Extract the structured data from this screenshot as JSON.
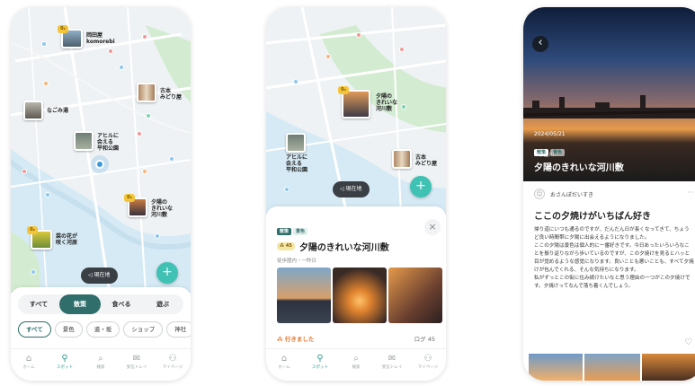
{
  "colors": {
    "accent": "#2f6e6a",
    "teal": "#3fc1b4",
    "water": "#d6eaf5",
    "park": "#d3ecd1"
  },
  "tabbar": [
    {
      "icon": "⌂",
      "label": "ホーム"
    },
    {
      "icon": "⚲",
      "label": "スポット"
    },
    {
      "icon": "⌕",
      "label": "検索"
    },
    {
      "icon": "✉",
      "label": "受信トレイ"
    },
    {
      "icon": "⚇",
      "label": "マイページ"
    }
  ],
  "screen1": {
    "places": [
      {
        "name": "岡田屋\nkomorebi"
      },
      {
        "name": "古本\nみどり屋"
      },
      {
        "name": "なごみ湯"
      },
      {
        "name": "アヒルに\n会える\n平和公園"
      },
      {
        "name": "夕陽の\nきれいな\n河川敷"
      },
      {
        "name": "菜の花が\n咲く河原"
      }
    ],
    "badge": "0₀",
    "current_location": "現在地",
    "fab_icon": "+",
    "segments": [
      "すべて",
      "散策",
      "食べる",
      "遊ぶ"
    ],
    "filters": [
      "すべて",
      "景色",
      "道・坂",
      "ショップ",
      "神社"
    ]
  },
  "screen2": {
    "places": [
      {
        "name": "夕陽の\nきれいな\n河川敷"
      },
      {
        "name": "アヒルに\n会える\n平和公園"
      },
      {
        "name": "古本\nみどり屋"
      }
    ],
    "current_location": "現在地",
    "tags": [
      "散策",
      "景色"
    ],
    "count": "45",
    "title": "夕陽のきれいな河川敷",
    "subtitle": "徒歩圏内・一昨日",
    "close_icon": "×",
    "visited": "行きました",
    "log": "ログ 45"
  },
  "screen3": {
    "back_icon": "‹",
    "date": "2024/05/21",
    "tags": [
      "散策",
      "景色"
    ],
    "area": "二子玉川",
    "title": "夕陽のきれいな河川敷",
    "author": "おさんぽだいすき",
    "more_icon": "···",
    "post_title": "ここの夕焼けがいちばん好き",
    "body": "帰り道にいつも通るのですが、だんだん日が長くなってきて、ちょうど良い時間帯に夕陽に出会えるようになりました。\nここの夕陽は景色は個人的に一番好きです。今日あったいろいろなことを振り返りながら歩いているのですが、この夕焼けを見るとハッと目が覚めるような感覚になります。良いことも悪いことも、すべて夕焼けが包んでくれる、そんな気持ちになります。\n私がずっとこの街に住み続けたいなと思う理由の一つがこの夕焼けです。夕焼けってなんで落ち着くんでしょう。",
    "like_icon": "♡"
  }
}
